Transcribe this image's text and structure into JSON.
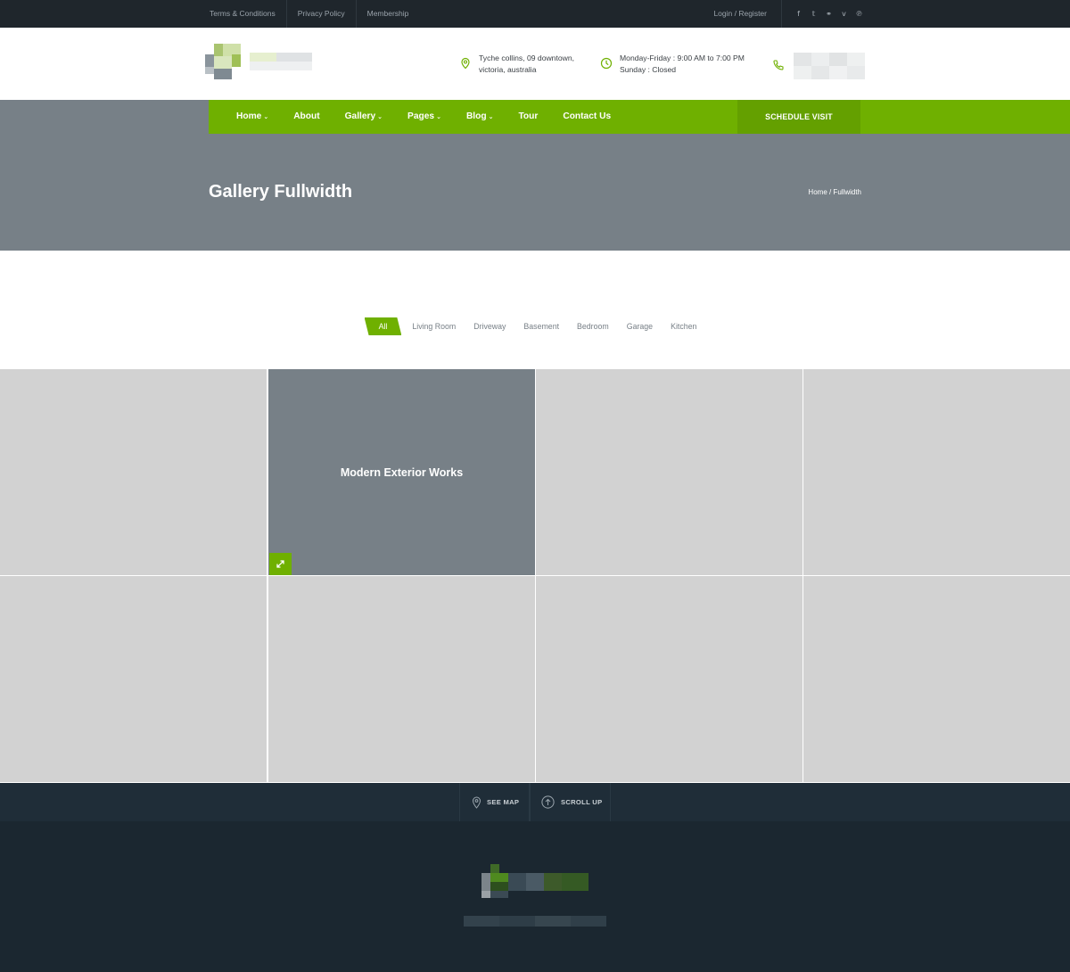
{
  "topbar": {
    "links": [
      "Terms & Conditions",
      "Privacy Policy",
      "Membership"
    ],
    "login": "Login / Register",
    "social_icons": [
      "facebook-icon",
      "twitter-icon",
      "link-icon",
      "vimeo-icon",
      "pinterest-icon"
    ],
    "social_glyphs": [
      "f",
      "𝕥",
      "⚭",
      "v",
      "℗"
    ]
  },
  "header": {
    "address_line1": "Tyche collins, 09 downtown,",
    "address_line2": "victoria, australia",
    "hours_line1": "Monday-Friday : 9:00 AM to 7:00 PM",
    "hours_line2": "Sunday : Closed"
  },
  "nav": {
    "items": [
      {
        "label": "Home",
        "dropdown": true
      },
      {
        "label": "About",
        "dropdown": false
      },
      {
        "label": "Gallery",
        "dropdown": true
      },
      {
        "label": "Pages",
        "dropdown": true
      },
      {
        "label": "Blog",
        "dropdown": true
      },
      {
        "label": "Tour",
        "dropdown": false
      },
      {
        "label": "Contact Us",
        "dropdown": false
      }
    ],
    "caret": "⌄",
    "cta": "SCHEDULE VISIT"
  },
  "hero": {
    "title": "Gallery Fullwidth",
    "breadcrumb": "Home / Fullwidth"
  },
  "filters": {
    "items": [
      "All",
      "Living Room",
      "Driveway",
      "Basement",
      "Bedroom",
      "Garage",
      "Kitchen"
    ],
    "active": "All"
  },
  "gallery": {
    "hovered_title": "Modern Exterior Works"
  },
  "footer": {
    "see_map": "SEE MAP",
    "scroll_up": "SCROLL UP"
  },
  "colors": {
    "accent": "#6fb000",
    "accent_dark": "#64a000",
    "topbar": "#1f262c",
    "hero": "#778087",
    "footer": "#1b2730",
    "tile": "#d2d2d2"
  }
}
